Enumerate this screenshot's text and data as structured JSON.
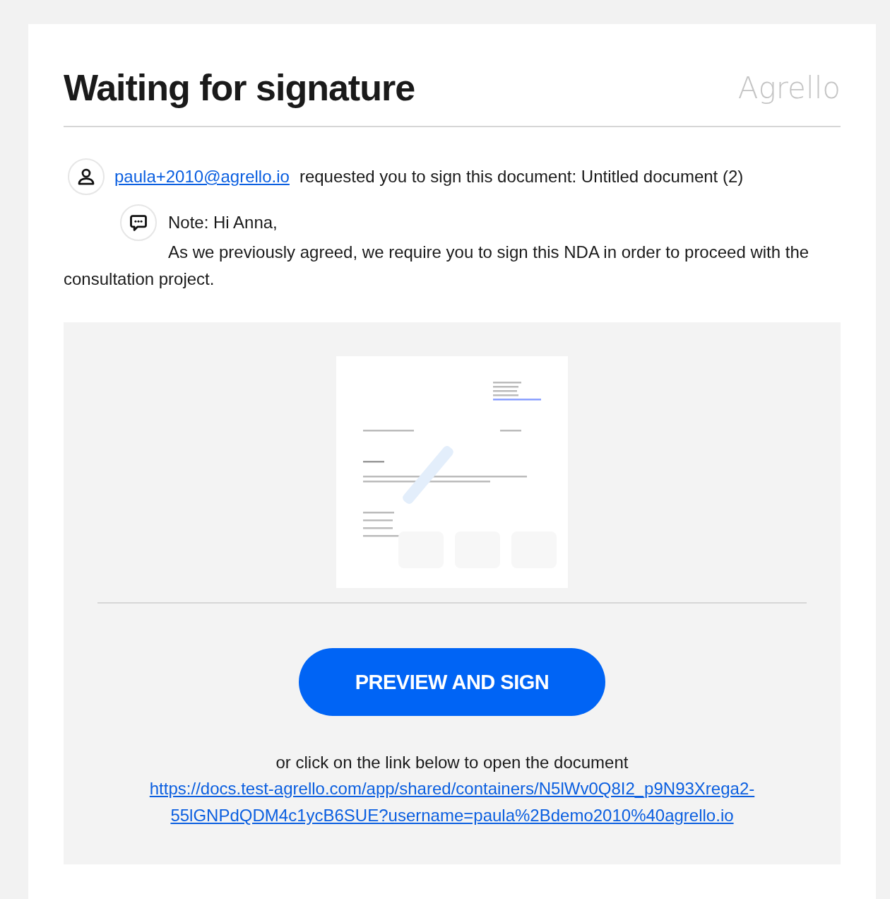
{
  "header": {
    "title": "Waiting for signature",
    "logo": "Agrello"
  },
  "request": {
    "sender": "paula+2010@agrello.io",
    "text": "requested you to sign this document: Untitled document (2)"
  },
  "note": {
    "lines": [
      "Note: Hi Anna,",
      "As we previously agreed, we require you to sign this NDA in order to proceed with the consultation project."
    ]
  },
  "action": {
    "button": "PREVIEW AND SIGN",
    "hint": "or click on the link below to open the document",
    "link": "https://docs.test-agrello.com/app/shared/containers/N5lWv0Q8I2_p9N93Xrega2-55lGNPdQDM4c1ycB6SUE?username=paula%2Bdemo2010%40agrello.io"
  }
}
